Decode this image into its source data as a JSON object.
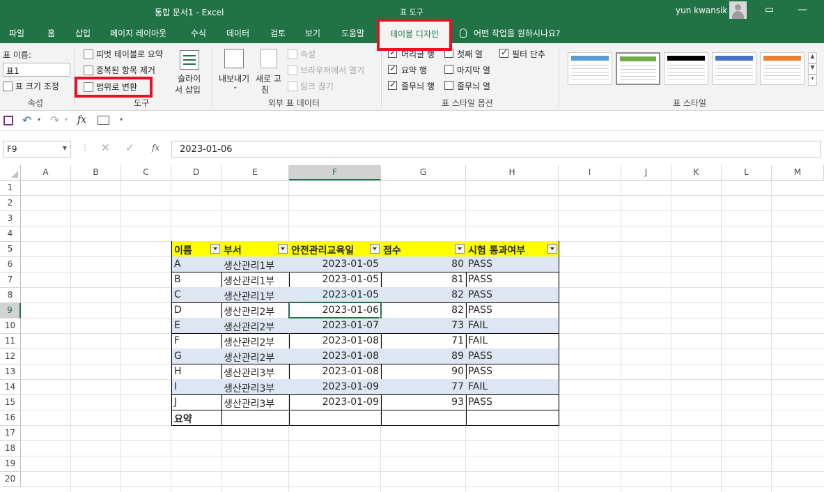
{
  "titlebar": {
    "title": "통합 문서1  -  Excel",
    "tool_tab": "표 도구",
    "user": "yun kwansik"
  },
  "tabs": [
    "파일",
    "홈",
    "삽입",
    "페이지 레이아웃",
    "수식",
    "데이터",
    "검토",
    "보기",
    "도움말"
  ],
  "active_tab": "테이블 디자인",
  "tell_me": "어떤 작업을 원하시나요?",
  "ribbon": {
    "properties": {
      "table_name_label": "표 이름:",
      "table_name_value": "표1",
      "resize": "표 크기 조정",
      "group": "속성"
    },
    "tools": {
      "pivot": "피벗 테이블로 요약",
      "remove_dupes": "중복된 항목 제거",
      "convert": "범위로 변환",
      "slicer_line1": "슬라이",
      "slicer_line2": "서 삽입",
      "group": "도구"
    },
    "external": {
      "export": "내보내기",
      "refresh_line1": "새로 고",
      "refresh_line2": "침",
      "properties": "속성",
      "open_browser": "브라우저에서 열기",
      "unlink": "링크 끊기",
      "group": "외부 표 데이터"
    },
    "style_options": {
      "header_row": "머리글 행",
      "first_col": "첫째 열",
      "filter_button": "필터 단추",
      "total_row": "요약 행",
      "last_col": "마지막 열",
      "banded_rows": "줄무늬 행",
      "banded_cols": "줄무늬 열",
      "group": "표 스타일 옵션"
    },
    "styles": {
      "group": "표 스타일",
      "swatches": [
        "#5b9bd5",
        "#70ad47",
        "#000000",
        "#4472c4",
        "#ed7d31"
      ]
    }
  },
  "formula_bar": {
    "name_box": "F9",
    "fx": "fx",
    "value": "2023-01-06"
  },
  "columns": [
    "A",
    "B",
    "C",
    "D",
    "E",
    "F",
    "G",
    "H",
    "I",
    "J",
    "K",
    "L",
    "M"
  ],
  "rows": [
    "1",
    "2",
    "3",
    "4",
    "5",
    "6",
    "7",
    "8",
    "9",
    "10",
    "11",
    "12",
    "13",
    "14",
    "15",
    "16",
    "17",
    "18",
    "19",
    "20"
  ],
  "table": {
    "headers": [
      "이름",
      "부서",
      "안전관리교육일",
      "점수",
      "시험 통과여부"
    ],
    "rows": [
      [
        "A",
        "생산관리1부",
        "2023-01-05",
        "80",
        "PASS"
      ],
      [
        "B",
        "생산관리1부",
        "2023-01-05",
        "81",
        "PASS"
      ],
      [
        "C",
        "생산관리1부",
        "2023-01-05",
        "82",
        "PASS"
      ],
      [
        "D",
        "생산관리2부",
        "2023-01-06",
        "82",
        "PASS"
      ],
      [
        "E",
        "생산관리2부",
        "2023-01-07",
        "73",
        "FAIL"
      ],
      [
        "F",
        "생산관리2부",
        "2023-01-08",
        "71",
        "FAIL"
      ],
      [
        "G",
        "생산관리2부",
        "2023-01-08",
        "89",
        "PASS"
      ],
      [
        "H",
        "생산관리3부",
        "2023-01-08",
        "90",
        "PASS"
      ],
      [
        "I",
        "생산관리3부",
        "2023-01-09",
        "77",
        "FAIL"
      ],
      [
        "J",
        "생산관리3부",
        "2023-01-09",
        "93",
        "PASS"
      ]
    ],
    "total_label": "요약"
  },
  "colors": {
    "excel_green": "#217346",
    "header_fill": "#ffff00",
    "band_fill": "#dde6f2",
    "highlight_red": "#e81123"
  }
}
